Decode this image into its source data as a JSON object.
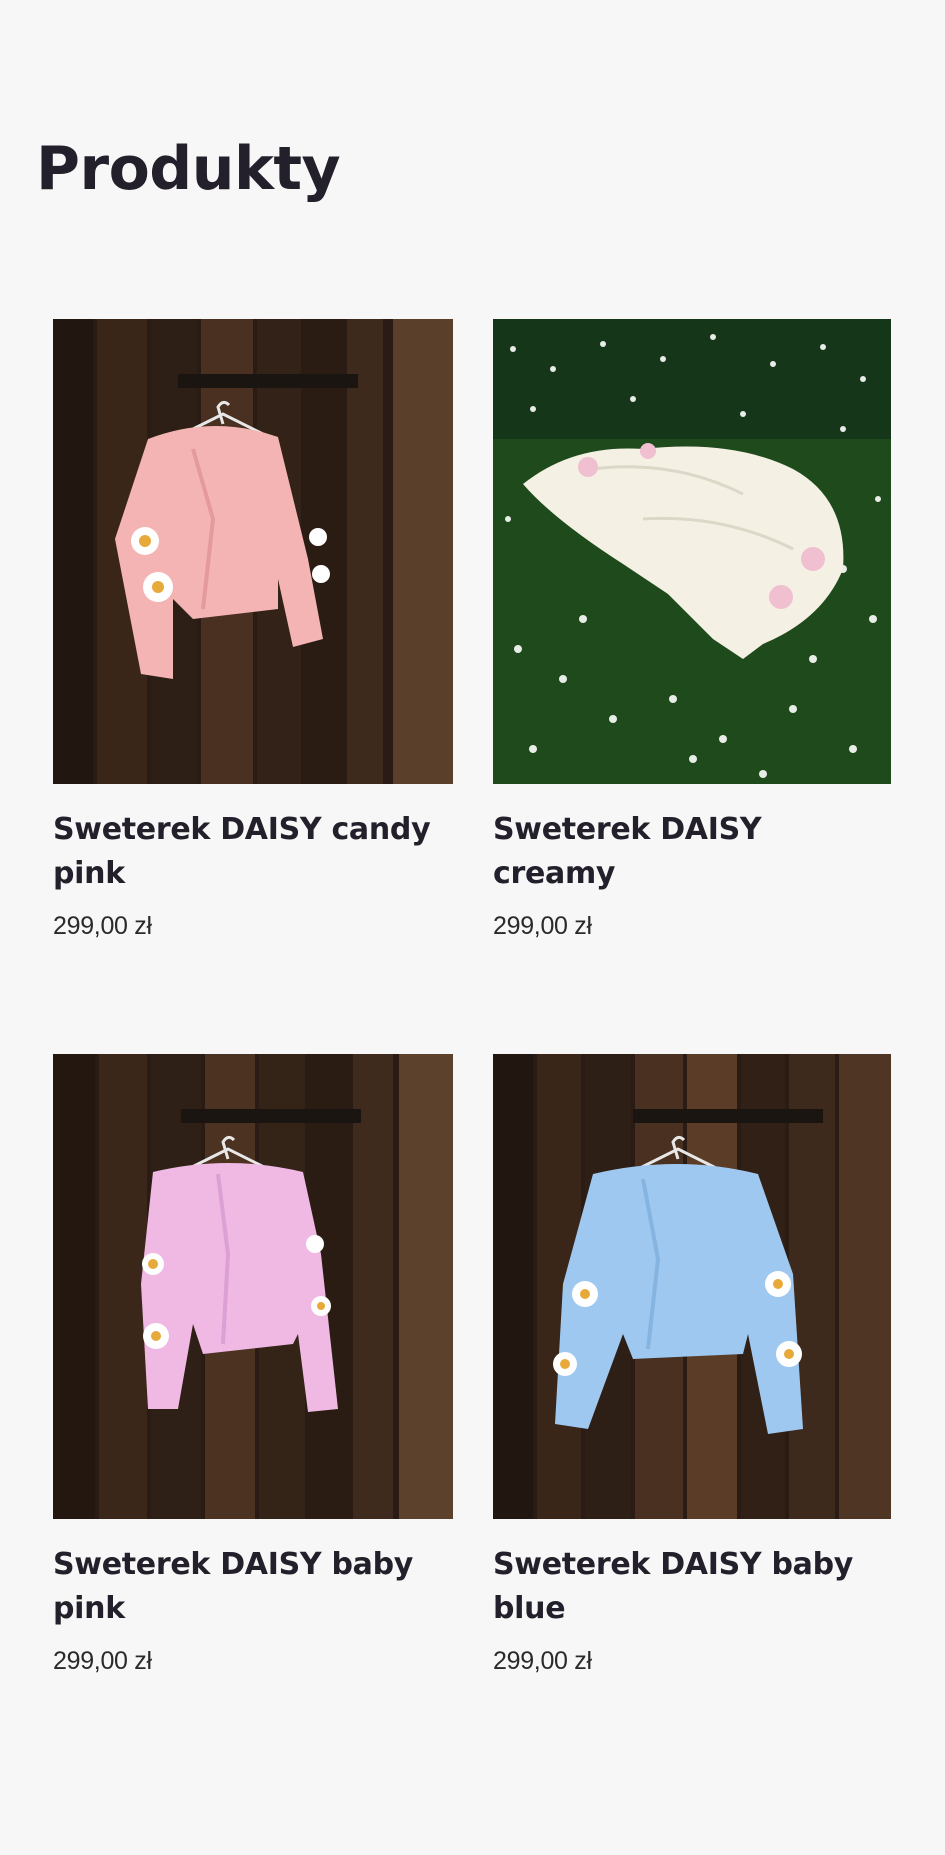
{
  "page": {
    "title": "Produkty"
  },
  "products": [
    {
      "title": "Sweterek DAISY candy pink",
      "price": "299,00 zł",
      "image_icon": "pink-sweater-on-door-photo",
      "sweater_color": "#f3b4b3"
    },
    {
      "title": "Sweterek DAISY creamy",
      "price": "299,00 zł",
      "image_icon": "cream-sweater-on-grass-photo",
      "sweater_color": "#f4f1e4"
    },
    {
      "title": "Sweterek DAISY baby pink",
      "price": "299,00 zł",
      "image_icon": "lilac-sweater-on-door-photo",
      "sweater_color": "#efb9e4"
    },
    {
      "title": "Sweterek DAISY baby blue",
      "price": "299,00 zł",
      "image_icon": "blue-sweater-on-door-photo",
      "sweater_color": "#9fc8f0"
    }
  ],
  "colors": {
    "background": "#f7f7f7",
    "text": "#23202b",
    "wood_dark": "#2b1d15",
    "grass": "#1f4a1c"
  }
}
